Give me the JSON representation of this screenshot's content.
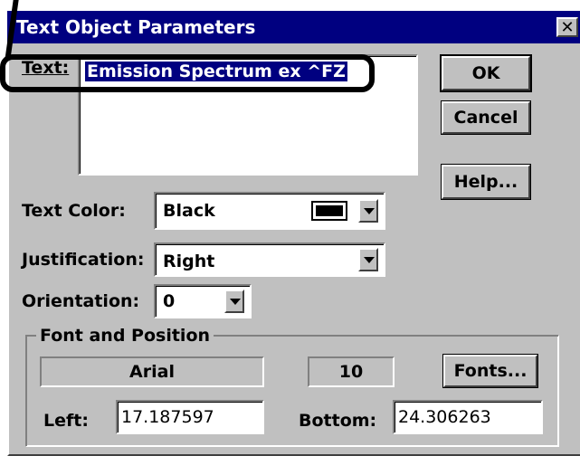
{
  "window": {
    "title": "Text Object Parameters",
    "close_glyph": "✕"
  },
  "text_field": {
    "label": "Text:",
    "value": "Emission Spectrum ex ^FZ"
  },
  "buttons": {
    "ok": "OK",
    "cancel": "Cancel",
    "help": "Help...",
    "fonts": "Fonts..."
  },
  "text_color": {
    "label": "Text Color:",
    "value": "Black",
    "swatch": "#000000"
  },
  "justification": {
    "label": "Justification:",
    "value": "Right"
  },
  "orientation": {
    "label": "Orientation:",
    "value": "0"
  },
  "font_position": {
    "legend": "Font and Position",
    "font_name": "Arial",
    "font_size": "10",
    "left_label": "Left:",
    "left_value": "17.187597",
    "bottom_label": "Bottom:",
    "bottom_value": "24.306263"
  },
  "colors": {
    "titlebar": "#000080",
    "dialog_bg": "#c0c0c0",
    "selection": "#000080"
  }
}
